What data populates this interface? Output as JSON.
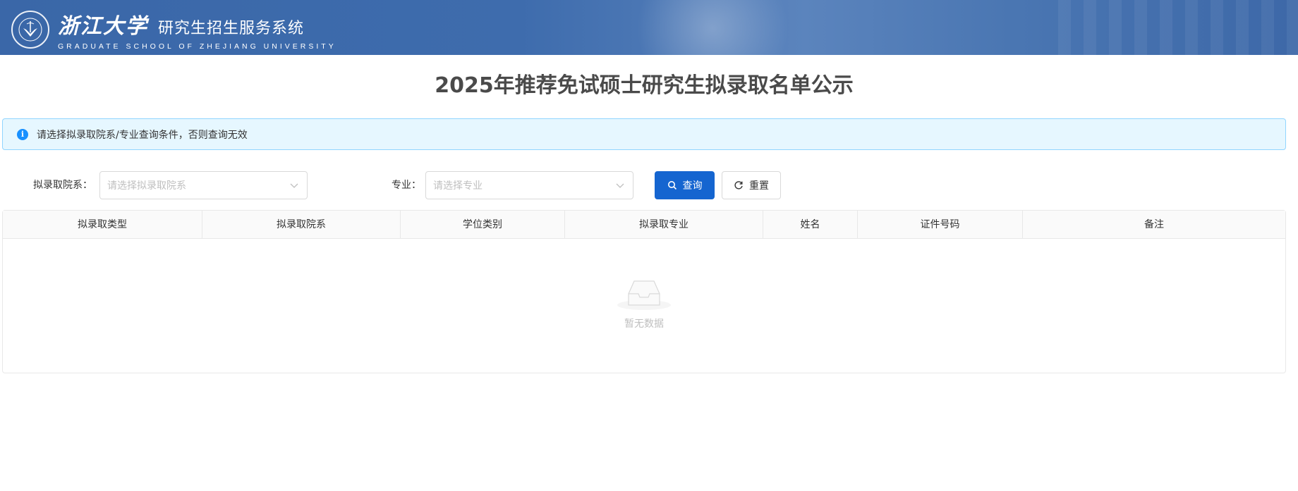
{
  "header": {
    "university_name": "浙江大学",
    "system_name": "研究生招生服务系统",
    "english_name": "GRADUATE SCHOOL OF ZHEJIANG UNIVERSITY",
    "emblem_icon": "university-emblem-icon"
  },
  "page": {
    "title": "2025年推荐免试硕士研究生拟录取名单公示"
  },
  "alert": {
    "icon": "info-icon",
    "text": "请选择拟录取院系/专业查询条件，否则查询无效"
  },
  "filters": {
    "department_label": "拟录取院系：",
    "department_placeholder": "请选择拟录取院系",
    "major_label": "专业：",
    "major_placeholder": "请选择专业",
    "search_label": "查询",
    "reset_label": "重置"
  },
  "table": {
    "columns": [
      "拟录取类型",
      "拟录取院系",
      "学位类别",
      "拟录取专业",
      "姓名",
      "证件号码",
      "备注"
    ],
    "rows": [],
    "empty_text": "暂无数据"
  },
  "colors": {
    "header_bg": "#3a67a8",
    "primary": "#1565d0",
    "alert_bg": "#e6f7ff",
    "alert_border": "#91d5ff",
    "info": "#1890ff"
  }
}
